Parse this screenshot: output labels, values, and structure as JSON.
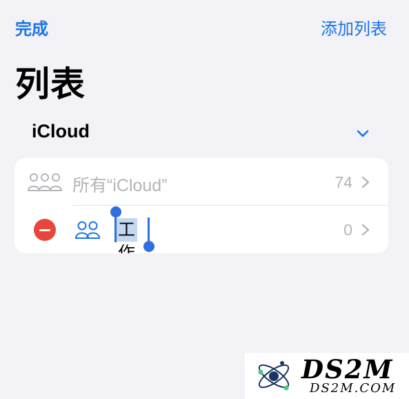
{
  "header": {
    "done_label": "完成",
    "add_list_label": "添加列表"
  },
  "page": {
    "title": "列表"
  },
  "section": {
    "title": "iCloud",
    "chevron_icon": "chevron-down-icon"
  },
  "lists": {
    "all": {
      "label": "所有“iCloud”",
      "count": "74",
      "icon": "people-group-icon"
    },
    "work": {
      "label": "工作",
      "count": "0",
      "icon": "people-icon",
      "editing": true,
      "text_selected": true
    }
  },
  "colors": {
    "accent": "#1a73e8",
    "background": "#f2f2f7",
    "card": "#ffffff",
    "delete_red": "#e8453c",
    "secondary_text": "#b4b4b9",
    "selection": "#c5d8f3",
    "caret": "#2f6fe0"
  },
  "watermark": {
    "title": "DS2M",
    "subtitle": "DS2M.COM"
  }
}
